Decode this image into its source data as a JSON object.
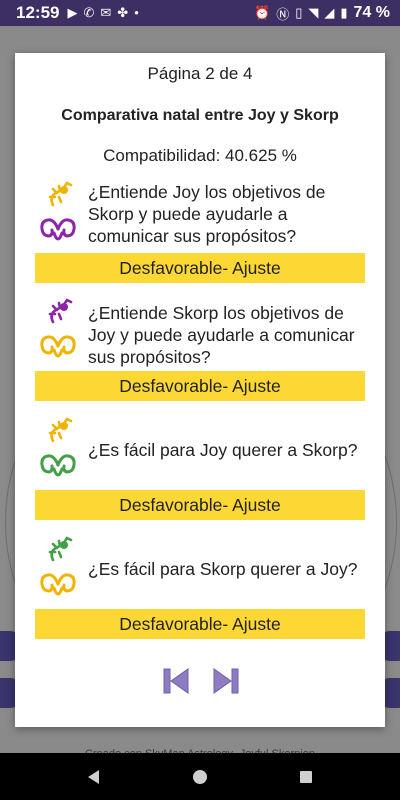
{
  "status_bar": {
    "time": "12:59",
    "battery": "74 %"
  },
  "dialog": {
    "page_indicator": "Página 2 de 4",
    "title": "Comparativa natal entre Joy y Skorp",
    "compatibility": "Compatibilidad: 40.625 %",
    "questions": [
      {
        "text": "¿Entiende Joy los objetivos de Skorp y puede ayudarle a comunicar sus propósitos?",
        "verdict": "Desfavorable- Ajuste",
        "sign1": "scorpio-icon",
        "sign1_color": "#f0b400",
        "sign2": "aries-icon",
        "sign2_color": "#8e24aa"
      },
      {
        "text": "¿Entiende Skorp los objetivos de Joy y puede ayudarle a comunicar sus propósitos?",
        "verdict": "Desfavorable- Ajuste",
        "sign1": "scorpio-icon",
        "sign1_color": "#8e24aa",
        "sign2": "aries-icon",
        "sign2_color": "#f0b400"
      },
      {
        "text": "¿Es fácil para Joy querer a Skorp?",
        "verdict": "Desfavorable- Ajuste",
        "sign1": "scorpio-icon",
        "sign1_color": "#f0b400",
        "sign2": "aries-icon",
        "sign2_color": "#43a047"
      },
      {
        "text": "¿Es fácil para Skorp querer a Joy?",
        "verdict": "Desfavorable- Ajuste",
        "sign1": "scorpio-icon",
        "sign1_color": "#43a047",
        "sign2": "aries-icon",
        "sign2_color": "#f0b400"
      }
    ],
    "nav": {
      "prev_icon": "skip-previous-icon",
      "next_icon": "skip-next-icon",
      "color": "#8e7cc3"
    }
  },
  "background": {
    "credit": "Creado con SkyMap Astrology- Joyful Skorpion"
  }
}
